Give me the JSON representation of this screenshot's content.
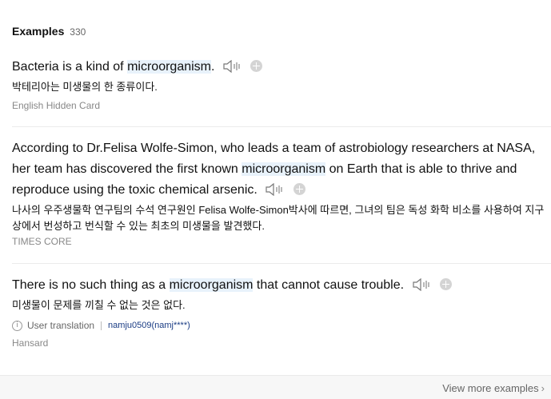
{
  "header": {
    "title": "Examples",
    "count": "330"
  },
  "examples": [
    {
      "en_before": "Bacteria is a kind of ",
      "keyword": "microorganism",
      "en_after": ".",
      "ko": "박테리아는 미생물의 한 종류이다.",
      "source": "English Hidden Card"
    },
    {
      "en_before": "According to Dr.Felisa Wolfe-Simon, who leads a team of astrobiology researchers at NASA, her team has discovered the first known ",
      "keyword": "microorganism",
      "en_after": " on Earth that is able to thrive and reproduce using the toxic chemical arsenic.",
      "ko": "나사의 우주생물학 연구팀의 수석 연구원인 Felisa Wolfe-Simon박사에 따르면, 그녀의 팀은 독성 화학 비소를 사용하여 지구상에서 번성하고 번식할 수 있는 최초의 미생물을 발견했다.",
      "source": "TIMES CORE"
    },
    {
      "en_before": "There is no such thing as a ",
      "keyword": "microorganism",
      "en_after": " that cannot cause trouble.",
      "ko": "미생물이 문제를 끼칠 수 없는 것은 없다.",
      "meta_label": "User translation",
      "meta_user": "namju0509(namj****)",
      "source": "Hansard"
    }
  ],
  "footer": {
    "more_label": "View more examples"
  }
}
